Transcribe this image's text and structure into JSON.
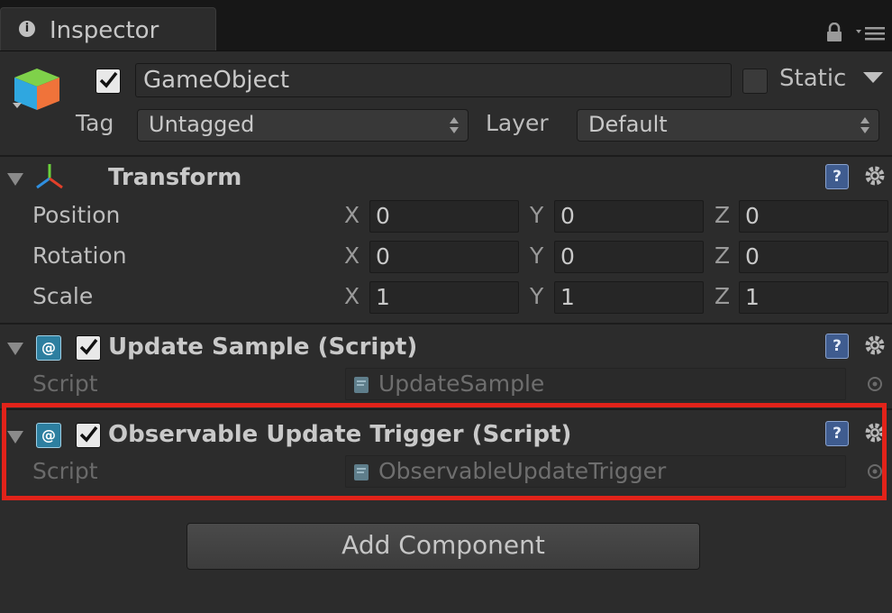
{
  "tab": {
    "label": "Inspector",
    "icon": "info-icon"
  },
  "header": {
    "object_name": "GameObject",
    "active_checked": true,
    "static_label": "Static",
    "static_checked": false,
    "tag_label": "Tag",
    "tag_value": "Untagged",
    "layer_label": "Layer",
    "layer_value": "Default"
  },
  "transform": {
    "title": "Transform",
    "rows": [
      {
        "label": "Position",
        "x": "0",
        "y": "0",
        "z": "0"
      },
      {
        "label": "Rotation",
        "x": "0",
        "y": "0",
        "z": "0"
      },
      {
        "label": "Scale",
        "x": "1",
        "y": "1",
        "z": "1"
      }
    ],
    "axis_x": "X",
    "axis_y": "Y",
    "axis_z": "Z"
  },
  "components": [
    {
      "title": "Update Sample (Script)",
      "enabled": true,
      "script_label": "Script",
      "script_value": "UpdateSample"
    },
    {
      "title": "Observable Update Trigger (Script)",
      "enabled": true,
      "script_label": "Script",
      "script_value": "ObservableUpdateTrigger"
    }
  ],
  "help_glyph": "?",
  "cs_glyph": "@",
  "add_component_label": "Add Component",
  "colors": {
    "highlight": "#e2231a",
    "help_blue": "#3f5c8f",
    "cs_blue": "#2d7fa0"
  }
}
